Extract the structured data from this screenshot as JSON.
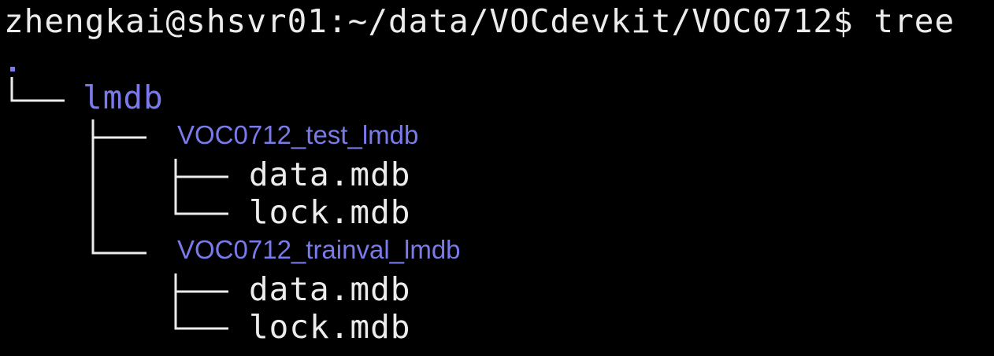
{
  "terminal": {
    "prompt": "zhengkai@shsvr01:~/data/VOCdevkit/VOC0712$",
    "command": "tree"
  },
  "tree": {
    "root": ".",
    "dir": "lmdb",
    "subdirs": [
      {
        "name": "VOC0712_test_lmdb",
        "files": [
          "data.mdb",
          "lock.mdb"
        ]
      },
      {
        "name": "VOC0712_trainval_lmdb",
        "files": [
          "data.mdb",
          "lock.mdb"
        ]
      }
    ]
  },
  "colors": {
    "background": "#000000",
    "text": "#ececec",
    "directory": "#7a7aea"
  }
}
